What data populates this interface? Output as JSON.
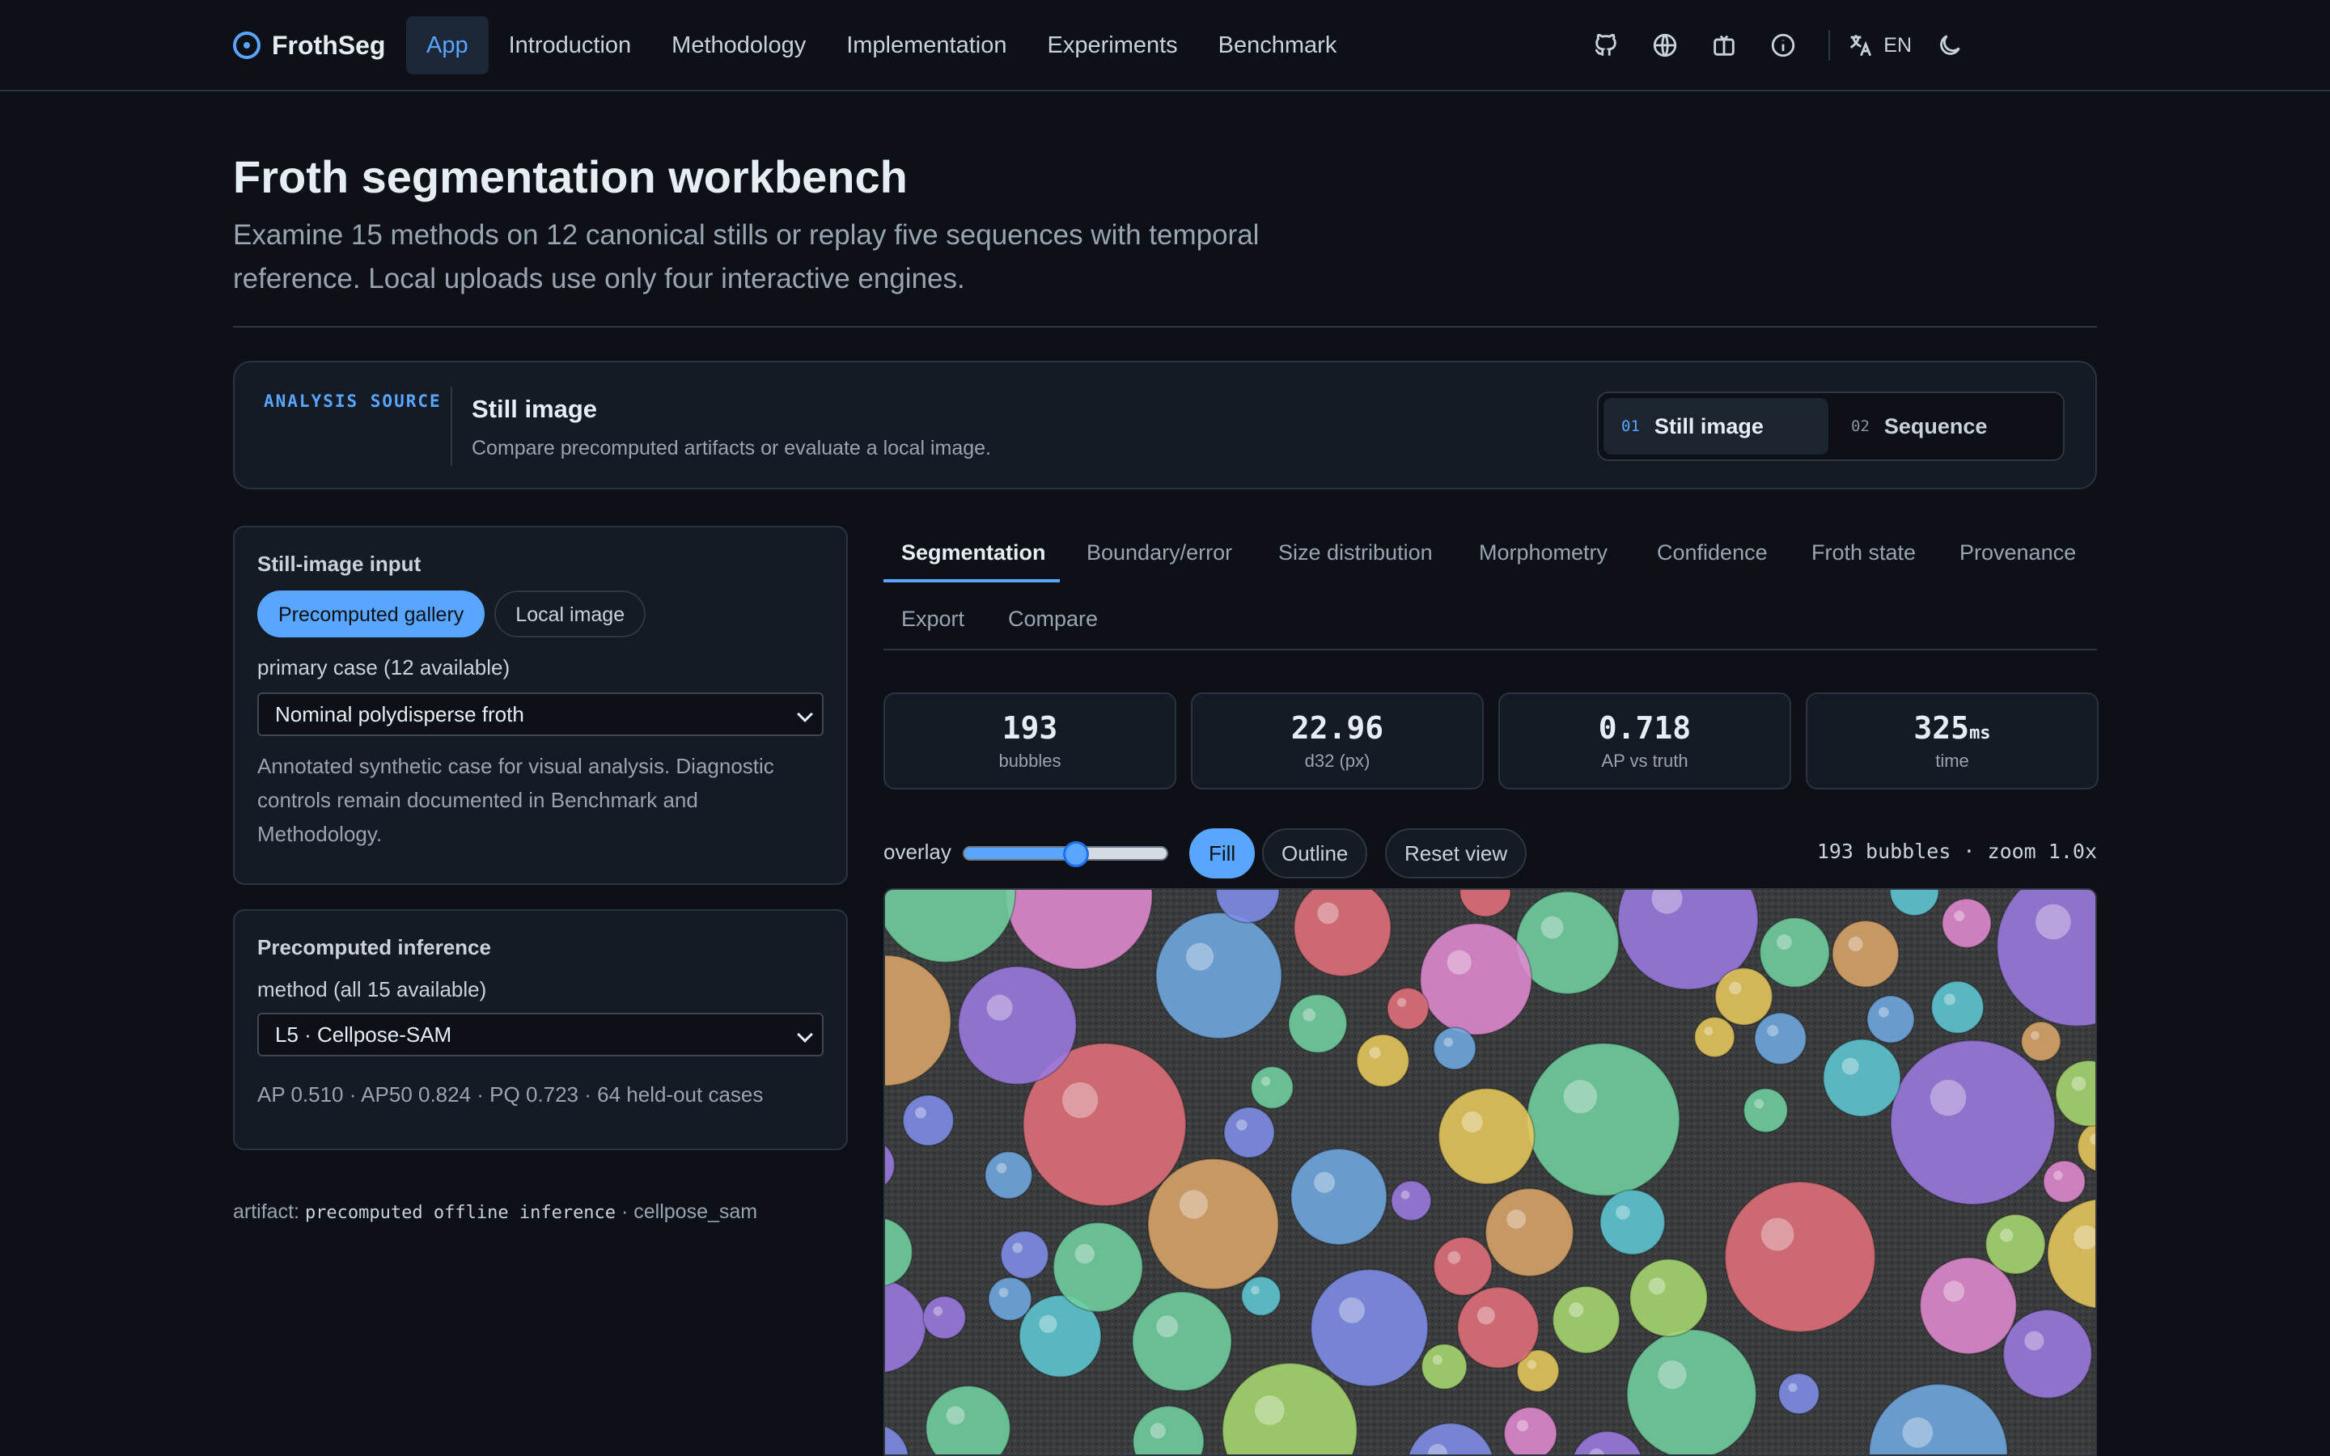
{
  "nav": {
    "brand": "FrothSeg",
    "links": [
      "App",
      "Introduction",
      "Methodology",
      "Implementation",
      "Experiments",
      "Benchmark"
    ],
    "active": "App",
    "icons": [
      "github-icon",
      "globe-icon",
      "gift-icon",
      "info-icon"
    ],
    "lang": "EN",
    "theme_icon": "moon-icon"
  },
  "header": {
    "title": "Froth segmentation workbench",
    "description": "Examine 15 methods on 12 canonical stills or replay five sequences with temporal reference. Local uploads use only four interactive engines."
  },
  "source": {
    "eyebrow": "ANALYSIS SOURCE",
    "title": "Still image",
    "subtitle": "Compare precomputed artifacts or evaluate a local image.",
    "options": [
      {
        "num": "01",
        "label": "Still image",
        "active": true
      },
      {
        "num": "02",
        "label": "Sequence",
        "active": false
      }
    ]
  },
  "input_panel": {
    "title": "Still-image input",
    "modes": [
      "Precomputed gallery",
      "Local image"
    ],
    "active_mode": "Precomputed gallery",
    "case_label": "primary case (12 available)",
    "case_value": "Nominal polydisperse froth",
    "help": "Annotated synthetic case for visual analysis. Diagnostic controls remain documented in Benchmark and Methodology."
  },
  "inference_panel": {
    "title": "Precomputed inference",
    "method_label": "method (all 15 available)",
    "method_value": "L5 · Cellpose-SAM",
    "scores": "AP 0.510 · AP50 0.824 · PQ 0.723 · 64 held-out cases"
  },
  "artifact": {
    "prefix": "artifact:",
    "code": "precomputed offline inference",
    "suffix": "· cellpose_sam"
  },
  "tabs": {
    "items": [
      "Segmentation",
      "Boundary/error",
      "Size distribution",
      "Morphometry",
      "Confidence",
      "Froth state",
      "Provenance",
      "Export",
      "Compare"
    ],
    "active": "Segmentation"
  },
  "metrics": [
    {
      "value": "193",
      "unit": "",
      "label": "bubbles"
    },
    {
      "value": "22.96",
      "unit": "",
      "label": "d32 (px)"
    },
    {
      "value": "0.718",
      "unit": "",
      "label": "AP vs truth"
    },
    {
      "value": "325",
      "unit": "ms",
      "label": "time"
    }
  ],
  "toolbar": {
    "overlay_label": "overlay",
    "overlay_value": 0.55,
    "fill_label": "Fill",
    "outline_label": "Outline",
    "reset_label": "Reset view",
    "status": "193 bubbles · zoom 1.0x",
    "active_style": "Fill"
  },
  "colors": {
    "accent": "#58a6ff",
    "background": "#0d1117",
    "panel": "#141b25"
  }
}
